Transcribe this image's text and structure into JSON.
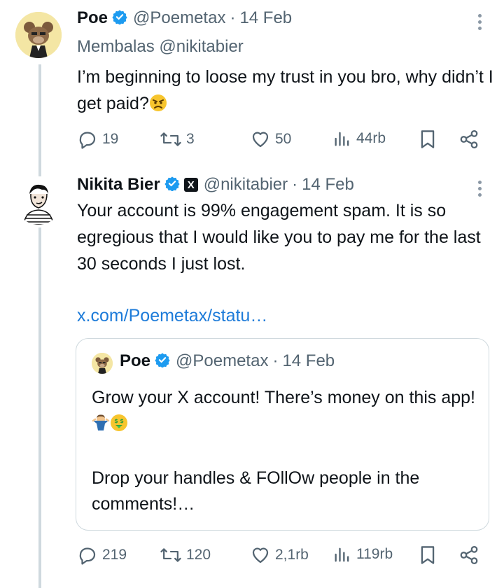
{
  "tweet1": {
    "name": "Poe",
    "handle": "@Poemetax",
    "separator": "·",
    "date": "14 Feb",
    "reply_to": "Membalas @nikitabier",
    "text": "I’m beginning to loose my trust in you bro, why didn’t I get paid?",
    "emoji": "angry-face",
    "replies": "19",
    "reposts": "3",
    "likes": "50",
    "views": "44rb"
  },
  "tweet2": {
    "name": "Nikita Bier",
    "handle": "@nikitabier",
    "separator": "·",
    "date": "14 Feb",
    "affiliate_badge": "X",
    "text": "Your account is 99% engagement spam. It is so egregious that I would like you to pay me for the last 30 seconds I just lost.",
    "link": "x.com/Poemetax/statu…",
    "replies": "219",
    "reposts": "120",
    "likes": "2,1rb",
    "views": "119rb"
  },
  "quote": {
    "name": "Poe",
    "handle": "@Poemetax",
    "separator": "·",
    "date": "14 Feb",
    "line1": "Grow your X account! There’s money on this app!",
    "line2": "Drop your handles & FOllOw people in the comments!…",
    "emojis": [
      "man-shrugging",
      "money-mouth-face"
    ]
  },
  "colors": {
    "text": "#0f1419",
    "secondary": "#536471",
    "verified": "#1d9bf0",
    "link": "#1d7bd9",
    "border": "#cfd9de"
  }
}
